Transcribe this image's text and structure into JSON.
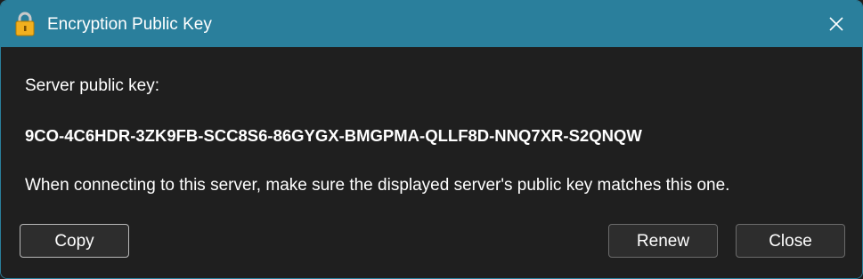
{
  "window": {
    "title": "Encryption Public Key",
    "title_icon": "padlock-icon",
    "close_icon": "close-icon",
    "accent_color": "#2a7f9c",
    "background_color": "#1f1f1f"
  },
  "body": {
    "label": "Server public key:",
    "public_key": "9CO-4C6HDR-3ZK9FB-SCC8S6-86GYGX-BMGPMA-QLLF8D-NNQ7XR-S2QNQW",
    "info": "When connecting to this server, make sure the displayed server's public key matches this one."
  },
  "buttons": {
    "copy_label": "Copy",
    "renew_label": "Renew",
    "close_label": "Close"
  }
}
